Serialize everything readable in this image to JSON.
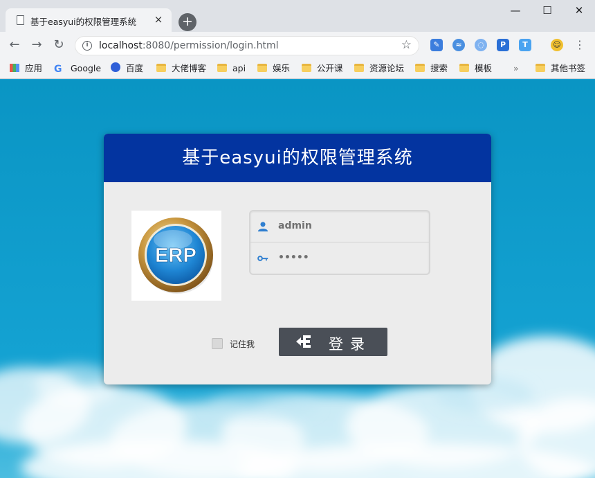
{
  "window": {
    "tab_title": "基于easyui的权限管理系统",
    "tab_close": "×",
    "new_tab": "+",
    "minimize": "—",
    "maximize": "☐",
    "close": "✕"
  },
  "toolbar": {
    "back": "←",
    "forward": "→",
    "reload": "↻",
    "url_host": "localhost",
    "url_rest": ":8080/permission/login.html",
    "bookmark_star": "☆",
    "menu": "⋮"
  },
  "bookmarks": {
    "items": [
      {
        "label": "应用",
        "icon": "apps-grid-icon"
      },
      {
        "label": "Google",
        "icon": "google-icon"
      },
      {
        "label": "百度",
        "icon": "baidu-icon"
      },
      {
        "label": "大佬博客",
        "icon": "folder-icon"
      },
      {
        "label": "api",
        "icon": "folder-icon"
      },
      {
        "label": "娱乐",
        "icon": "folder-icon"
      },
      {
        "label": "公开课",
        "icon": "folder-icon"
      },
      {
        "label": "资源论坛",
        "icon": "folder-icon"
      },
      {
        "label": "搜索",
        "icon": "folder-icon"
      },
      {
        "label": "模板",
        "icon": "folder-icon"
      }
    ],
    "overflow": "»",
    "other": "其他书签"
  },
  "login": {
    "title": "基于easyui的权限管理系统",
    "logo_text": "ERP",
    "username": "admin",
    "password_mask": "•••••",
    "remember_label": "记住我",
    "remember_checked": false,
    "submit_label": "登录"
  },
  "colors": {
    "page_bg": "#0d9ac9",
    "header_bg": "#0334a0",
    "button_bg": "#4a4f57"
  }
}
